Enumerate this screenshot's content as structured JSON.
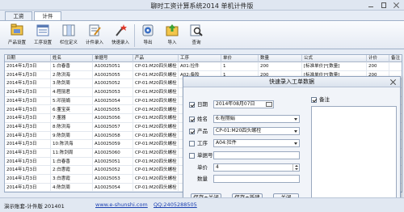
{
  "window": {
    "title": "聊时工资计算系统2014 单机计件版"
  },
  "tabs": [
    {
      "label": "工资"
    },
    {
      "label": "计件"
    }
  ],
  "toolbar": [
    {
      "label": "产品设置",
      "icon": "product-settings-icon"
    },
    {
      "label": "工序设置",
      "icon": "process-settings-icon"
    },
    {
      "label": "栏位定义",
      "icon": "column-define-icon"
    },
    {
      "label": "计件录入",
      "icon": "piece-entry-icon"
    },
    {
      "label": "快速录入",
      "icon": "quick-entry-icon"
    },
    {
      "label": "导出",
      "icon": "export-icon"
    },
    {
      "label": "导入",
      "icon": "import-icon"
    },
    {
      "label": "查询",
      "icon": "search-icon"
    }
  ],
  "grid": {
    "columns": [
      "日期",
      "姓名",
      "单据号",
      "产品",
      "工序",
      "单价",
      "数量",
      "公式",
      "计价",
      "备注"
    ],
    "rows": [
      [
        "2014年1月3日",
        "1:白春香",
        "A10025051",
        "CP-01:M20四头螺栓",
        "A01:捡件",
        "1",
        "200",
        "[标准单价]*[数量]",
        "200",
        ""
      ],
      [
        "2014年1月3日",
        "2:陈洪海",
        "A10025055",
        "CP-01:M20四头螺栓",
        "A02:备胶",
        "1",
        "200",
        "[标准单价]*[数量]",
        "200",
        ""
      ],
      [
        "2014年1月3日",
        "3:陈剑周",
        "A10025052",
        "CP-01:M20四头螺栓",
        "",
        "",
        "",
        "",
        "",
        ""
      ],
      [
        "2014年1月3日",
        "4:程丽君",
        "A10025053",
        "CP-01:M20四头螺栓",
        "",
        "",
        "",
        "",
        "",
        ""
      ],
      [
        "2014年1月3日",
        "5:邓丽娟",
        "A10025054",
        "CP-01:M20四头螺栓",
        "",
        "",
        "",
        "",
        "",
        ""
      ],
      [
        "2014年1月3日",
        "6:董宝英",
        "A10025055",
        "CP-01:M20四头螺栓",
        "",
        "",
        "",
        "",
        "",
        ""
      ],
      [
        "2014年1月3日",
        "7:董器",
        "A10025056",
        "CP-01:M20四头螺栓",
        "",
        "",
        "",
        "",
        "",
        ""
      ],
      [
        "2014年1月3日",
        "8:陈洪海",
        "A10025057",
        "CP-01:M20四头螺栓",
        "",
        "",
        "",
        "",
        "",
        ""
      ],
      [
        "2014年1月3日",
        "9:陈剑周",
        "A10025058",
        "CP-01:M20四头螺栓",
        "",
        "",
        "",
        "",
        "",
        ""
      ],
      [
        "2014年1月3日",
        "10:陈洪海",
        "A10025059",
        "CP-01:M20四头螺栓",
        "",
        "",
        "",
        "",
        "",
        ""
      ],
      [
        "2014年1月3日",
        "11:陈剑周",
        "A10025060",
        "CP-01:M20四头螺栓",
        "",
        "",
        "",
        "",
        "",
        ""
      ],
      [
        "2014年1月3日",
        "1:白春香",
        "A10025051",
        "CP-01:M20四头螺栓",
        "",
        "",
        "",
        "",
        "",
        ""
      ],
      [
        "2014年1月3日",
        "2:白惠霞",
        "A10025052",
        "CP-01:M20四头螺栓",
        "",
        "",
        "",
        "",
        "",
        ""
      ],
      [
        "2014年1月3日",
        "3:白惠霞",
        "A10025053",
        "CP-01:M20四头螺栓",
        "",
        "",
        "",
        "",
        "",
        ""
      ],
      [
        "2014年1月3日",
        "4:陈剑周",
        "A10025054",
        "CP-01:M20四头螺栓",
        "",
        "",
        "",
        "",
        "",
        ""
      ],
      [
        "2014年1月3日",
        "5:陈洪海",
        "A10025055",
        "CP-01:M20四头螺栓",
        "",
        "",
        "",
        "",
        "",
        ""
      ]
    ]
  },
  "dialog": {
    "title": "快速录入工单数据",
    "fields": {
      "date": {
        "label": "日期",
        "value": "2014年08月07日",
        "checked": true
      },
      "name": {
        "label": "姓名",
        "value": "6:程丽娟",
        "checked": true
      },
      "product": {
        "label": "产品",
        "value": "CP-01:M20四头螺栓",
        "checked": true
      },
      "process": {
        "label": "工序",
        "value": "A04:捡件",
        "checked": false
      },
      "docno": {
        "label": "单据号",
        "value": "",
        "checked": false
      },
      "price": {
        "label": "单价",
        "value": "4"
      },
      "qty": {
        "label": "数量",
        "value": ""
      },
      "note": {
        "label": "备注",
        "checked": true
      }
    },
    "buttons": {
      "save_close": "保存+关闭",
      "save_new": "保存+新建",
      "close": "关闭"
    }
  },
  "statusbar": {
    "account": "演示账套-计件版 201401",
    "website": "www.e-shunshi.com",
    "qq": "QQ:2405288505"
  }
}
